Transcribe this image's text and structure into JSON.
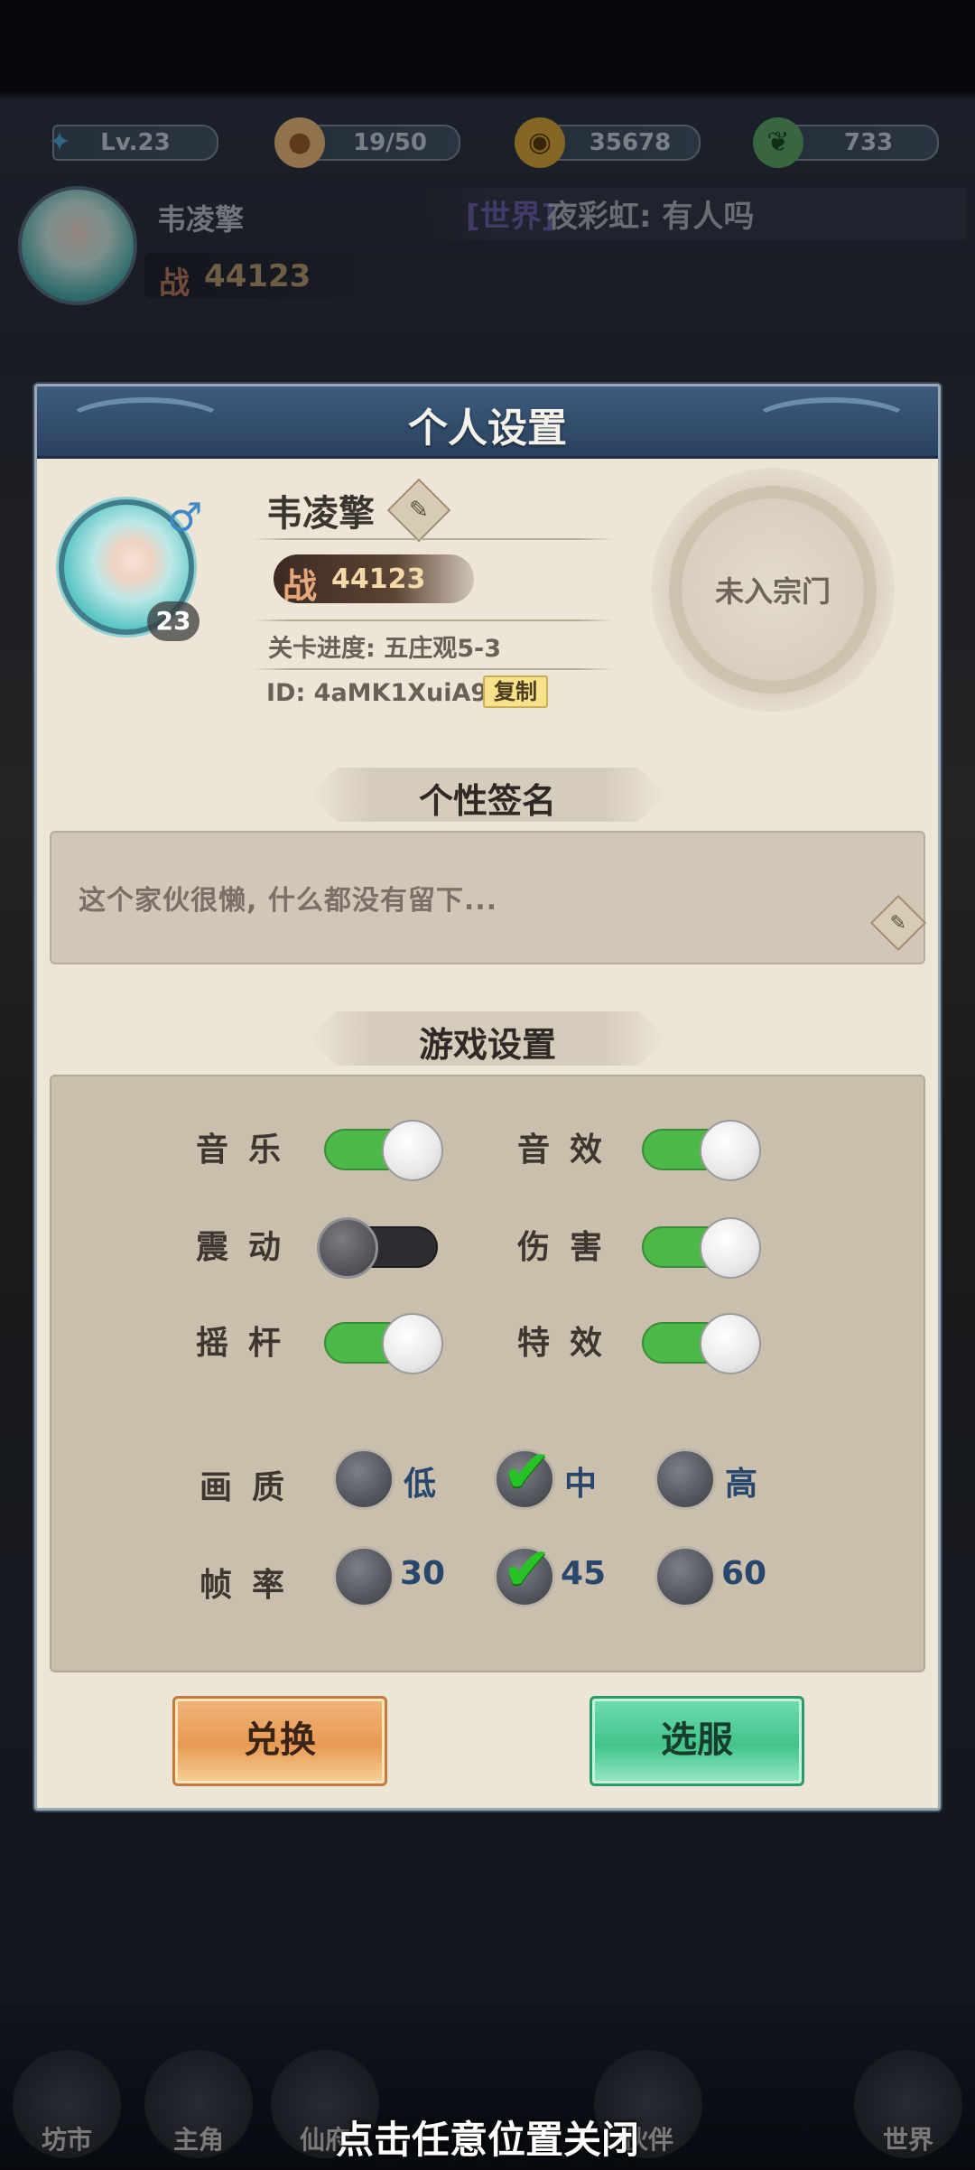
{
  "topbar": {
    "level": "Lv.23",
    "stamina": "19/50",
    "coins": "35678",
    "jade": "733"
  },
  "player": {
    "name": "韦凌擎",
    "power_label": "战",
    "power": "44123"
  },
  "chat": {
    "channel": "[世界]",
    "message": "夜彩虹: 有人吗"
  },
  "dialog": {
    "title": "个人设置",
    "username": "韦凌擎",
    "gender_symbol": "♂",
    "level": "23",
    "power_label": "战",
    "power": "44123",
    "stage_progress": "关卡进度: 五庄观5-3",
    "id_text": "ID: 4aMK1XuiA9i",
    "copy_label": "复制",
    "sect": "未入宗门",
    "signature_header": "个性签名",
    "signature": "这个家伙很懒, 什么都没有留下...",
    "game_settings_header": "游戏设置",
    "toggles": {
      "music": {
        "label": "音乐",
        "on": true
      },
      "sound": {
        "label": "音效",
        "on": true
      },
      "vibration": {
        "label": "震动",
        "on": false
      },
      "damage": {
        "label": "伤害",
        "on": true
      },
      "joystick": {
        "label": "摇杆",
        "on": true
      },
      "effects": {
        "label": "特效",
        "on": true
      }
    },
    "quality": {
      "label": "画质",
      "options": [
        "低",
        "中",
        "高"
      ],
      "selected": "中"
    },
    "framerate": {
      "label": "帧率",
      "options": [
        "30",
        "45",
        "60"
      ],
      "selected": "45"
    },
    "redeem_button": "兑换",
    "server_button": "选服"
  },
  "bottom_nav": [
    "坊市",
    "主角",
    "仙府",
    "伙伴",
    "世界"
  ],
  "close_hint": "点击任意位置关闭"
}
